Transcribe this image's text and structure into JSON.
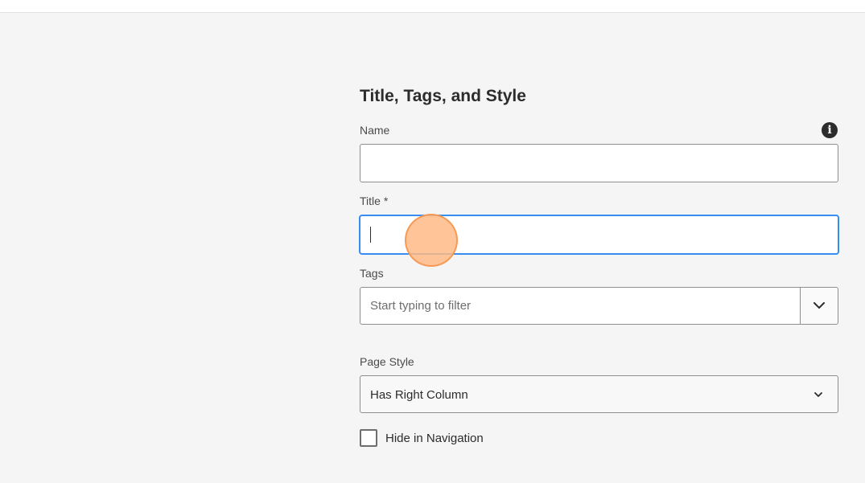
{
  "section": {
    "title": "Title, Tags, and Style"
  },
  "fields": {
    "name": {
      "label": "Name",
      "value": ""
    },
    "title": {
      "label": "Title *",
      "value": ""
    },
    "tags": {
      "label": "Tags",
      "placeholder": "Start typing to filter"
    },
    "page_style": {
      "label": "Page Style",
      "selected": "Has Right Column"
    },
    "hide_in_navigation": {
      "label": "Hide in Navigation",
      "checked": false
    }
  },
  "icons": {
    "info": "info-icon",
    "tags_toggle": "chevron-down-icon",
    "page_style_toggle": "chevron-down-icon"
  },
  "colors": {
    "background": "#f5f5f5",
    "focus_border": "#378ef0",
    "click_indicator": "#ffba85"
  }
}
